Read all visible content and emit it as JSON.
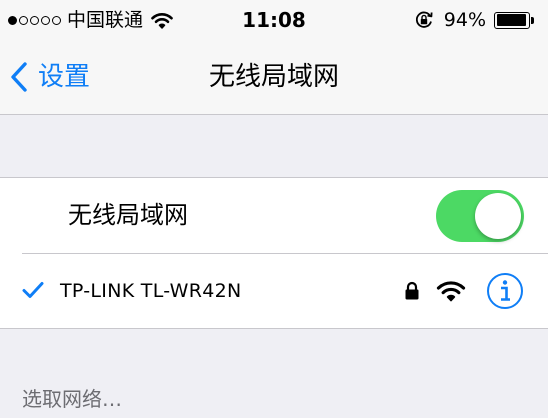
{
  "status_bar": {
    "carrier": "中国联通",
    "time": "11:08",
    "battery_percent": "94%",
    "battery_level": 0.94,
    "signal_bars_filled": 1,
    "signal_bars_total": 5
  },
  "nav": {
    "back_label": "设置",
    "title": "无线局域网"
  },
  "wlan": {
    "label": "无线局域网",
    "enabled": true
  },
  "connected_network": {
    "name": "TP-LINK TL-WR42N",
    "secured": true
  },
  "choose_network": {
    "header": "选取网络…"
  },
  "colors": {
    "accent": "#0f7ef6",
    "toggle_on": "#4cd964",
    "background": "#efeff4"
  },
  "icons": [
    "wifi-icon",
    "orientation-lock-icon",
    "battery-icon",
    "chevron-left-icon",
    "checkmark-icon",
    "lock-icon",
    "info-icon"
  ]
}
